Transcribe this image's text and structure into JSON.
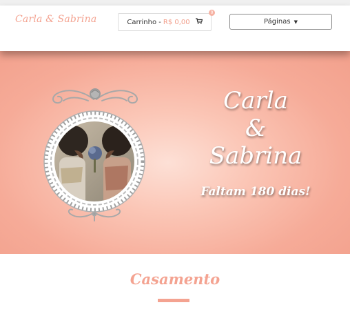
{
  "brand": "Carla & Sabrina",
  "cart": {
    "label": "Carrinho - ",
    "price": "R$ 0,00",
    "badge": "0",
    "icon": "shopping-cart-icon"
  },
  "pages_button": {
    "label": "Páginas",
    "icon": "caret-down-icon"
  },
  "hero": {
    "name1": "Carla",
    "ampersand": "&",
    "name2": "Sabrina",
    "countdown": "Faltam 180 dias!"
  },
  "section": {
    "title": "Casamento"
  },
  "colors": {
    "accent": "#f4a391",
    "hero_bg": "#f6ab98",
    "frame": "#9e9e9e"
  }
}
